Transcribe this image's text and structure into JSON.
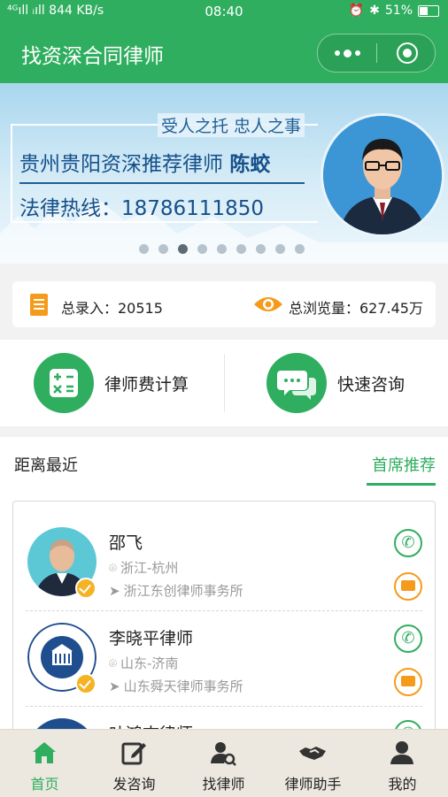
{
  "status_bar": {
    "network": "⁴ᴳıll ᵢıll 844 KB/s",
    "time": "08:40",
    "battery": "51%"
  },
  "nav": {
    "title": "找资深合同律师"
  },
  "banner": {
    "slogan": "受人之托 忠人之事",
    "headline": "贵州贵阳资深推荐律师",
    "lawyer_name": "陈蛟",
    "hotline": "法律热线：18786111850",
    "slide_count": 9,
    "active_slide": 3
  },
  "stats": {
    "entries_label": "总录入：20515",
    "views_label": "总浏览量：627.45万"
  },
  "actions": [
    {
      "label": "律师费计算",
      "icon": "calculator-icon"
    },
    {
      "label": "快速咨询",
      "icon": "chat-bubbles-icon"
    }
  ],
  "sort_tabs": {
    "nearest": "距离最近",
    "featured": "首席推荐",
    "active": "featured"
  },
  "lawyers": [
    {
      "name": "邵飞",
      "location": "浙江-杭州",
      "firm": "浙江东创律师事务所",
      "verified": true
    },
    {
      "name": "李晓平律师",
      "location": "山东-济南",
      "firm": "山东舜天律师事务所",
      "verified": true
    },
    {
      "name": "叶鸿志律师",
      "location": "",
      "firm": "",
      "verified": false
    }
  ],
  "tabbar": [
    {
      "label": "首页",
      "icon": "home-icon",
      "active": true
    },
    {
      "label": "发咨询",
      "icon": "edit-icon",
      "active": false
    },
    {
      "label": "找律师",
      "icon": "search-user-icon",
      "active": false
    },
    {
      "label": "律师助手",
      "icon": "handshake-icon",
      "active": false
    },
    {
      "label": "我的",
      "icon": "user-icon",
      "active": false
    }
  ],
  "colors": {
    "brand_green": "#2fae5f",
    "accent_orange": "#f59b1b",
    "banner_blue": "#16508a"
  }
}
